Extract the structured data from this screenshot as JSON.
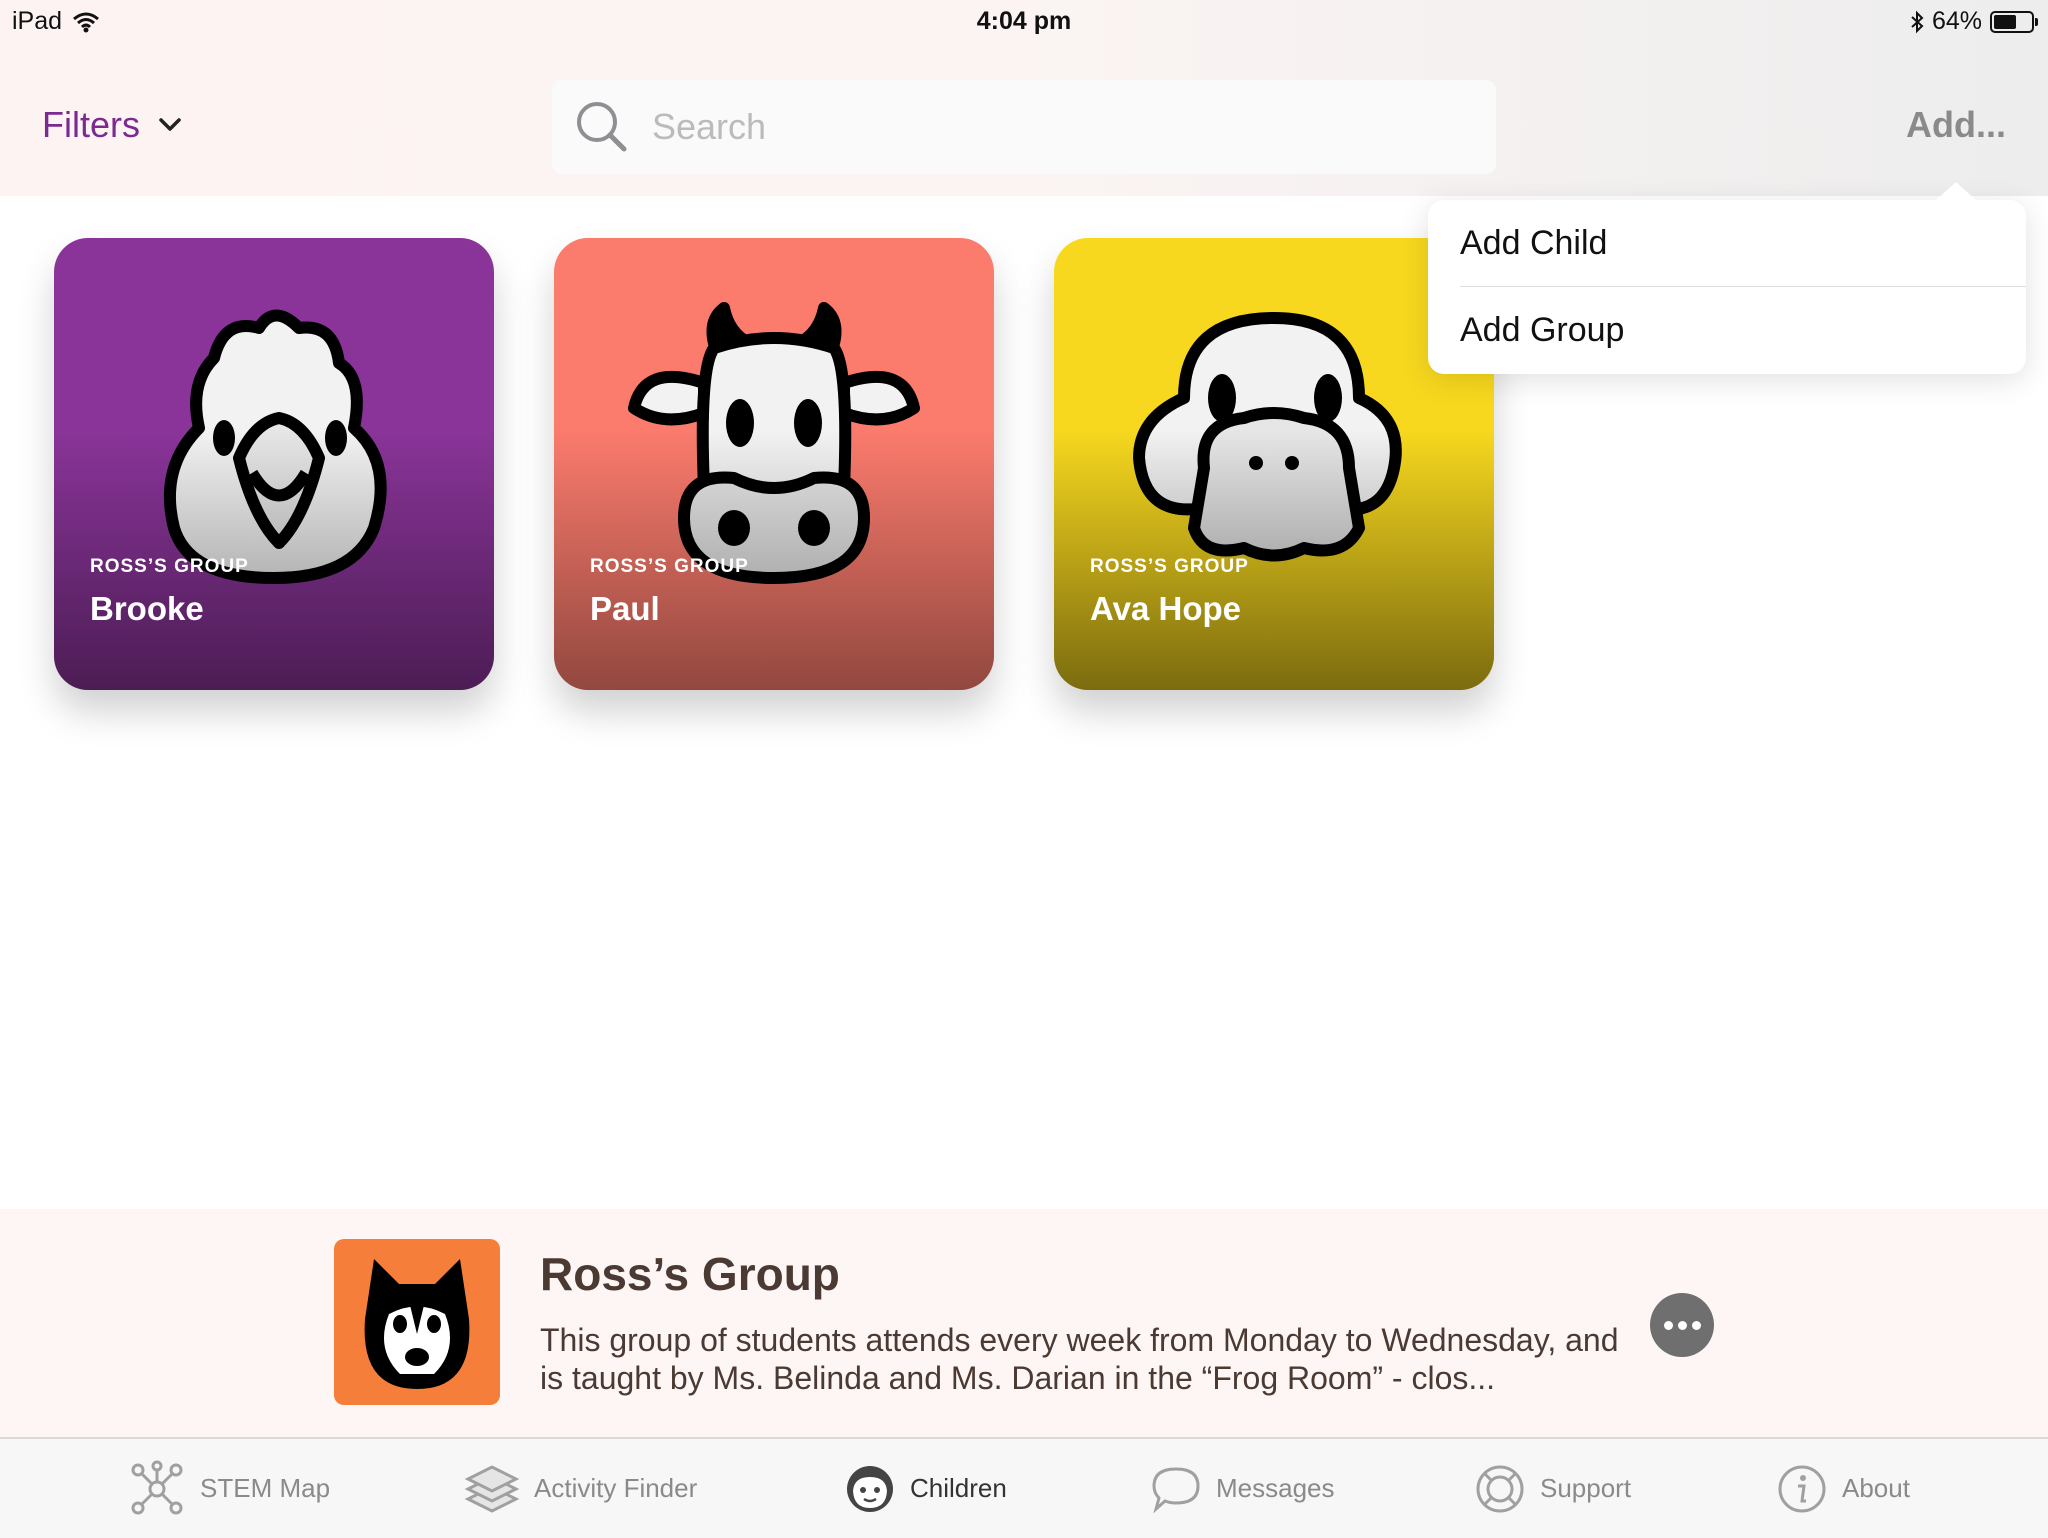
{
  "status_bar": {
    "device": "iPad",
    "time": "4:04 pm",
    "battery": "64%",
    "battery_level": 0.64
  },
  "header": {
    "filters_label": "Filters",
    "search_placeholder": "Search",
    "add_label": "Add..."
  },
  "add_menu": {
    "items": [
      "Add Child",
      "Add Group"
    ]
  },
  "children": [
    {
      "group": "ROSS’S GROUP",
      "name": "Brooke",
      "color": "#8a3499",
      "icon": "bird-icon"
    },
    {
      "group": "ROSS’S GROUP",
      "name": "Paul",
      "color": "#fb7b6d",
      "icon": "cow-icon"
    },
    {
      "group": "ROSS’S GROUP",
      "name": "Ava Hope",
      "color": "#f7d81e",
      "icon": "duck-icon"
    }
  ],
  "group_detail": {
    "title": "Ross’s Group",
    "description": "This group of students attends every week from Monday to Wednesday, and is taught by Ms. Belinda and Ms. Darian in the “Frog Room” - clos...",
    "icon": "husky-icon",
    "color": "#f57f3a"
  },
  "tabs": [
    {
      "label": "STEM Map",
      "icon": "network-icon",
      "active": false
    },
    {
      "label": "Activity Finder",
      "icon": "layers-icon",
      "active": false
    },
    {
      "label": "Children",
      "icon": "child-face-icon",
      "active": true
    },
    {
      "label": "Messages",
      "icon": "speech-bubble-icon",
      "active": false
    },
    {
      "label": "Support",
      "icon": "lifebuoy-icon",
      "active": false
    },
    {
      "label": "About",
      "icon": "info-icon",
      "active": false
    }
  ]
}
